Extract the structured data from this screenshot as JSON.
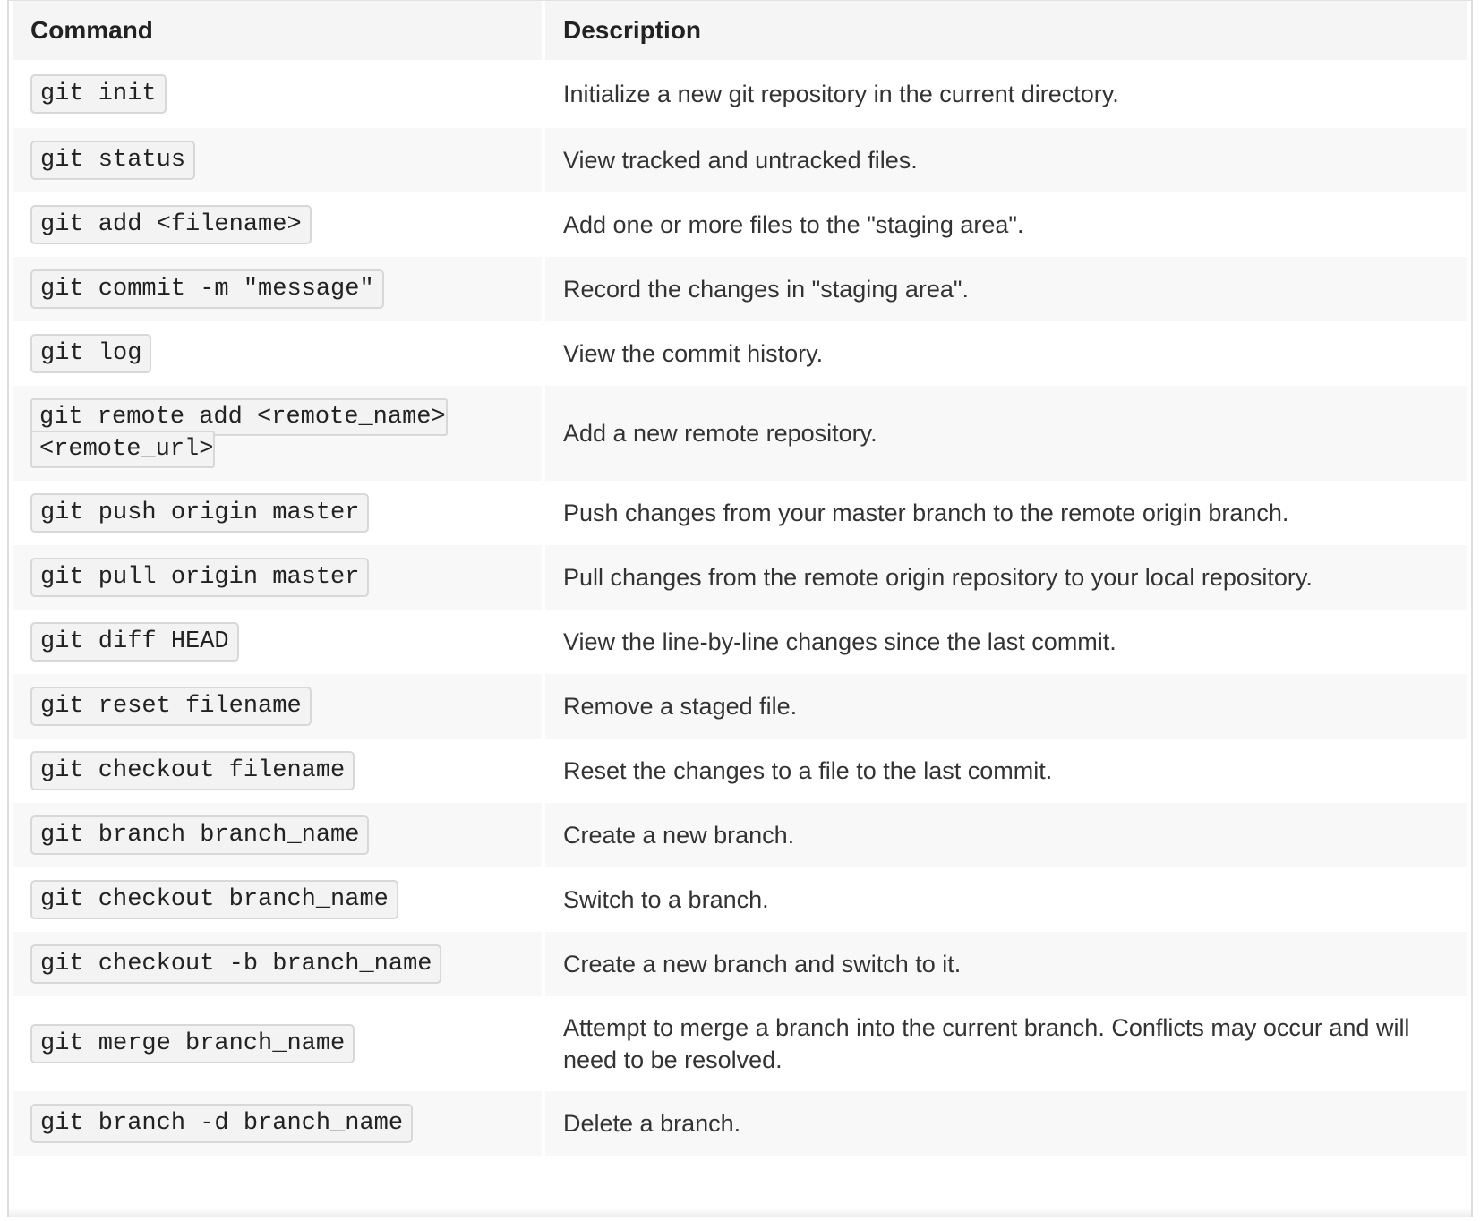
{
  "table": {
    "headers": {
      "command": "Command",
      "description": "Description"
    },
    "rows": [
      {
        "command": "git init",
        "description": "Initialize a new git repository in the current directory."
      },
      {
        "command": "git status",
        "description": "View tracked and untracked files."
      },
      {
        "command": "git add <filename>",
        "description": "Add one or more files to the \"staging area\"."
      },
      {
        "command": "git commit -m \"message\"",
        "description": "Record the changes in \"staging area\"."
      },
      {
        "command": "git log",
        "description": "View the commit history."
      },
      {
        "command": "git remote add <remote_name> <remote_url>",
        "description": "Add a new remote repository."
      },
      {
        "command": "git push origin master",
        "description": "Push changes from your master branch to the remote origin branch."
      },
      {
        "command": "git pull origin master",
        "description": "Pull changes from the remote origin repository to your local repository."
      },
      {
        "command": "git diff HEAD",
        "description": "View the line-by-line changes since the last commit."
      },
      {
        "command": "git reset filename",
        "description": "Remove a staged file."
      },
      {
        "command": "git checkout filename",
        "description": "Reset the changes to a file to the last commit."
      },
      {
        "command": "git branch branch_name",
        "description": "Create a new branch."
      },
      {
        "command": "git checkout branch_name",
        "description": "Switch to a branch."
      },
      {
        "command": "git checkout -b branch_name",
        "description": "Create a new branch and switch to it."
      },
      {
        "command": "git merge branch_name",
        "description": "Attempt to merge a branch into the current branch. Conflicts may occur and will need to be resolved."
      },
      {
        "command": "git branch -d branch_name",
        "description": "Delete a branch."
      }
    ]
  },
  "colors": {
    "header_bg": "#f5f5f5",
    "stripe_bg": "#f8f8f8",
    "code_bg": "#f3f3f3",
    "code_border": "#d8d8d8",
    "text": "#333333"
  }
}
